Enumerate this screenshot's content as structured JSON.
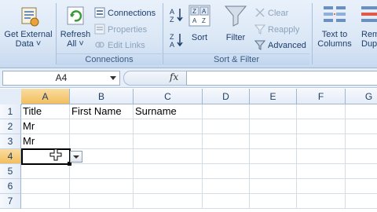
{
  "ribbon": {
    "get_external_data": {
      "line1": "Get External",
      "line2": "Data ˅"
    },
    "connections_group": {
      "refresh": {
        "line1": "Refresh",
        "line2": "All ˅"
      },
      "connections": "Connections",
      "properties": "Properties",
      "edit_links": "Edit Links",
      "label": "Connections"
    },
    "sort_filter_group": {
      "sort": "Sort",
      "filter": "Filter",
      "clear": "Clear",
      "reapply": "Reapply",
      "advanced": "Advanced",
      "label": "Sort & Filter"
    },
    "data_tools": {
      "text_to_columns": {
        "line1": "Text to",
        "line2": "Columns"
      },
      "remove_duplicates": {
        "line1": "Rem",
        "line2": "Dupli"
      }
    }
  },
  "formula_bar": {
    "name_box": "A4",
    "fx": "fx",
    "formula": ""
  },
  "sheet": {
    "columns": [
      "A",
      "B",
      "C",
      "D",
      "E",
      "F",
      "G"
    ],
    "rows": [
      "1",
      "2",
      "3",
      "4",
      "5",
      "6",
      "7"
    ],
    "cells": {
      "A1": "Title",
      "B1": "First Name",
      "C1": "Surname",
      "A2": "Mr",
      "A3": "Mr"
    },
    "active_cell": "A4"
  },
  "colors": {
    "ribbon_bg": "#dce8f6",
    "header_selected": "#f2bf5e",
    "grid_line": "#d4dce6"
  }
}
